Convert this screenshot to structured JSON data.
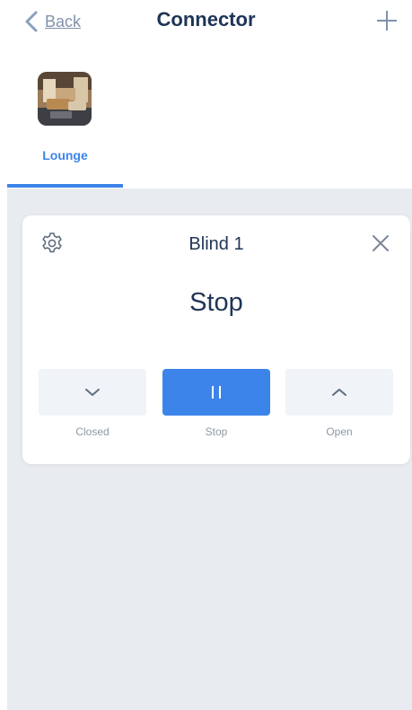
{
  "header": {
    "back_label": "Back",
    "title": "Connector",
    "back_icon": "chevron-left-icon",
    "add_icon": "plus-icon"
  },
  "rooms": [
    {
      "label": "Lounge",
      "selected": true
    }
  ],
  "blind_card": {
    "title": "Blind 1",
    "status": "Stop",
    "settings_icon": "gear-icon",
    "close_icon": "close-icon",
    "controls": [
      {
        "label": "Closed",
        "icon": "chevron-down-icon",
        "active": false
      },
      {
        "label": "Stop",
        "icon": "pause-icon",
        "active": true
      },
      {
        "label": "Open",
        "icon": "chevron-up-icon",
        "active": false
      }
    ]
  },
  "colors": {
    "accent": "#3d84ea",
    "title_text": "#1e3556",
    "muted_text": "#8d98a6",
    "background_gray": "#e8ebef",
    "button_gray": "#f0f3f7"
  }
}
